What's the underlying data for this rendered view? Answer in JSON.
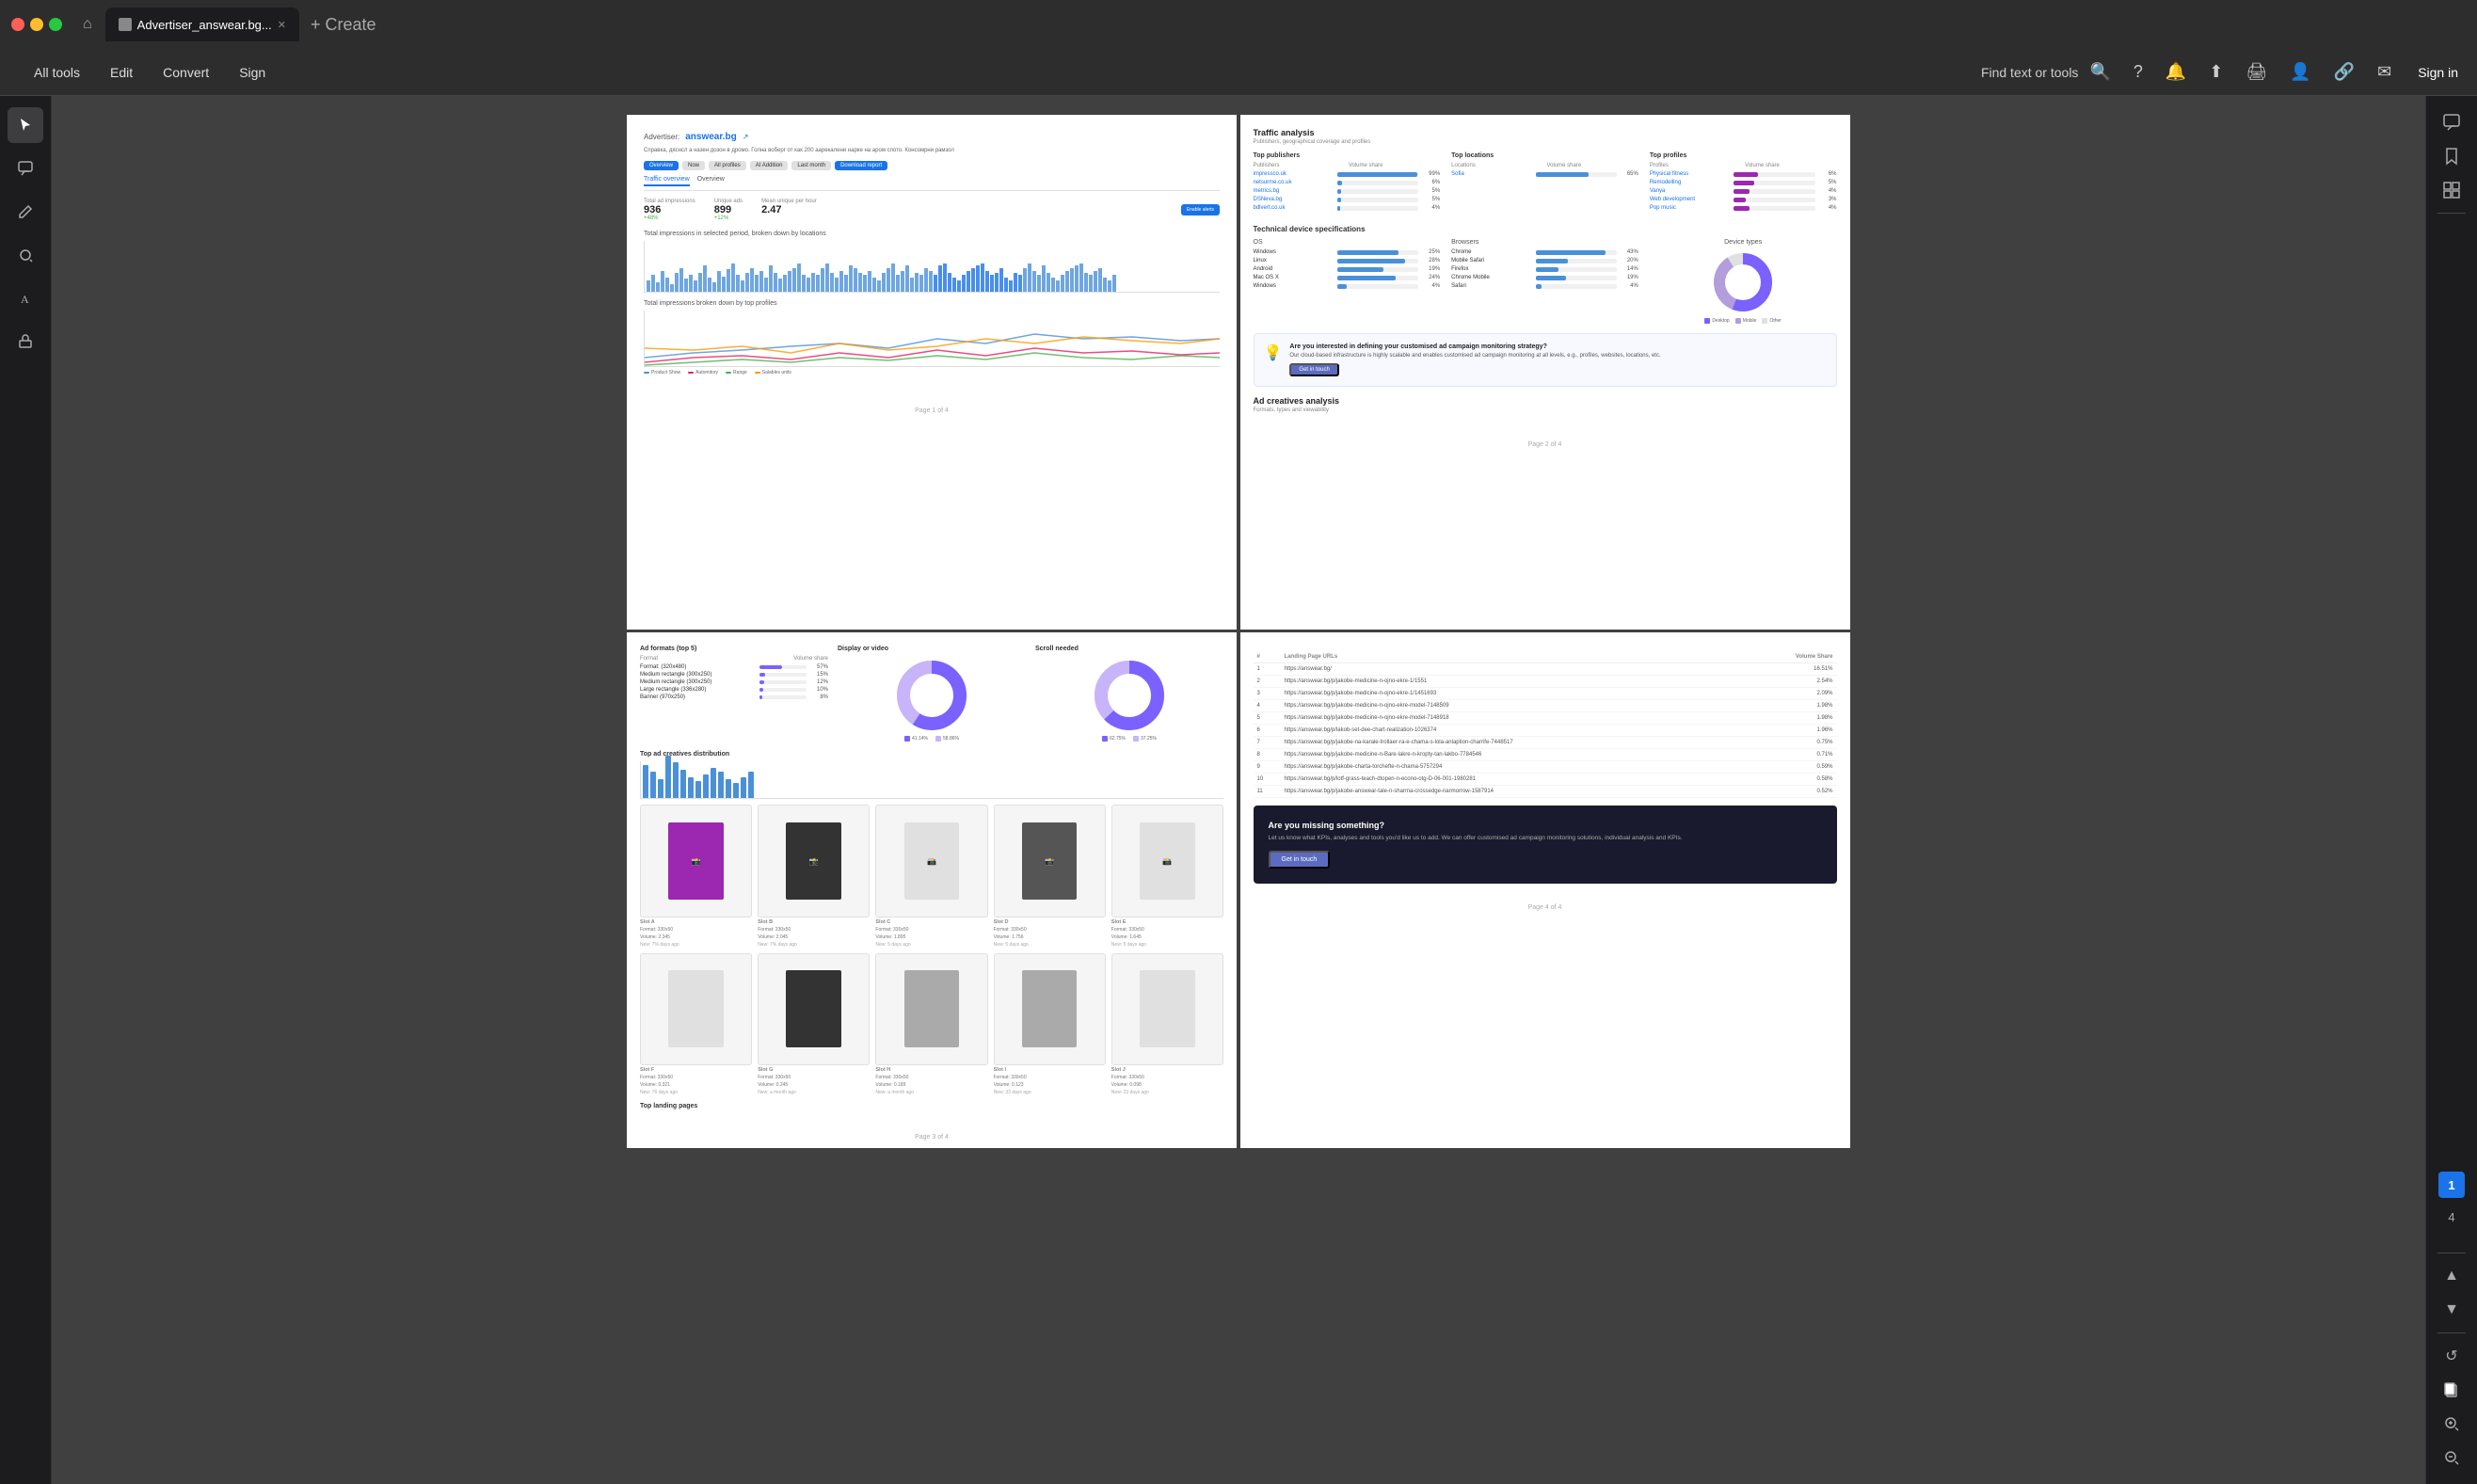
{
  "titleBar": {
    "tabTitle": "Advertiser_answear.bg...",
    "newTabLabel": "+ Create",
    "homeIcon": "⌂"
  },
  "toolbar": {
    "menuItems": [
      "All tools",
      "Edit",
      "Convert",
      "Sign"
    ],
    "findPlaceholder": "Find text or tools",
    "icons": [
      "help",
      "bell",
      "upload",
      "print",
      "account",
      "link",
      "mail"
    ]
  },
  "leftSidebar": {
    "icons": [
      "cursor",
      "comment",
      "pencil",
      "loop",
      "text",
      "stamp"
    ]
  },
  "pages": {
    "page1": {
      "advertiserLabel": "Advertiser:",
      "advertiserName": "answear.bg",
      "description": "Справка, дяснсл а назен дозон в дромо. Голна воберг от как 200 аарекалени нарке на аром спото. Консомрни рамзол",
      "btnOverview": "Overview",
      "btnNow": "Now",
      "btnAllProfiles": "All profiles",
      "btnAllAddition": "AI Addition",
      "btnLastMonth": "Last month",
      "btnDownloadReport": "Download report",
      "tabTrafficOverview": "Traffic overview",
      "tabOverview": "Overview",
      "stats": {
        "totalImpressions": {
          "label": "Total ad impressions",
          "value": "936",
          "change": "+48%"
        },
        "uniqueAds": {
          "label": "Unique ads",
          "value": "899",
          "change": "+12%"
        },
        "meanUnique": {
          "label": "Mean unique per hour",
          "value": "2.47"
        }
      },
      "chartTitle1": "Total impressions in selected period, broken down by locations",
      "chartTitle2": "Total impressions broken down by top profiles",
      "legendItems": [
        "Product Show",
        "Automitory",
        "Range",
        "Salables units"
      ],
      "footerText": "Page 1 of 4"
    },
    "page2": {
      "sectionTitle": "Traffic analysis",
      "sectionSubtitle": "Publishers, geographical coverage and profiles",
      "publishers": {
        "title": "Top publishers",
        "colHeaders": [
          "Publishers",
          "Volume share"
        ],
        "rows": [
          {
            "name": "impressco.uk",
            "pct": 99,
            "label": "99%"
          },
          {
            "name": "netsurme.co.uk",
            "pct": 6,
            "label": "6%"
          },
          {
            "name": "metrics.bg",
            "pct": 5,
            "label": "5%"
          },
          {
            "name": "DSNeva.bg",
            "pct": 5,
            "label": "5%"
          },
          {
            "name": "bdlvert.co.uk",
            "pct": 4,
            "label": "4%"
          }
        ]
      },
      "locations": {
        "title": "Top locations",
        "colHeaders": [
          "Locations",
          "Volume share"
        ],
        "rows": [
          {
            "name": "Sofia",
            "pct": 65,
            "label": "65%"
          }
        ]
      },
      "profiles": {
        "title": "Top profiles",
        "colHeaders": [
          "Profiles",
          "Volume share"
        ],
        "rows": [
          {
            "name": "Physical fitness",
            "pct": 6,
            "label": "6%"
          },
          {
            "name": "Remodelling",
            "pct": 5,
            "label": "5%"
          },
          {
            "name": "Vanya",
            "pct": 4,
            "label": "4%"
          },
          {
            "name": "Web development",
            "pct": 3,
            "label": "3%"
          },
          {
            "name": "Pop music",
            "pct": 4,
            "label": "4%"
          }
        ]
      },
      "techTitle": "Technical device specifications",
      "os": {
        "title": "OS",
        "rows": [
          {
            "name": "Windows",
            "pct": 25,
            "label": "25%"
          },
          {
            "name": "Linux",
            "pct": 28,
            "label": "28%"
          },
          {
            "name": "Android",
            "pct": 19,
            "label": "19%"
          },
          {
            "name": "Mac OS X",
            "pct": 24,
            "label": "24%"
          },
          {
            "name": "Windows",
            "pct": 4,
            "label": "4%"
          }
        ]
      },
      "browsers": {
        "title": "Browsers",
        "rows": [
          {
            "name": "Chrome",
            "pct": 43,
            "label": "43%"
          },
          {
            "name": "Mobile Safari",
            "pct": 20,
            "label": "20%"
          },
          {
            "name": "Firefox",
            "pct": 14,
            "label": "14%"
          },
          {
            "name": "Chrome Mobile",
            "pct": 19,
            "label": "19%"
          },
          {
            "name": "Safari",
            "pct": 4,
            "label": "4%"
          }
        ]
      },
      "deviceTypes": {
        "title": "Device types",
        "donutData": [
          {
            "label": "Desktop",
            "value": 55,
            "color": "#7b61ff"
          },
          {
            "label": "Mobile",
            "value": 35,
            "color": "#b39ddb"
          },
          {
            "label": "Other",
            "value": 10,
            "color": "#e0e0e0"
          }
        ]
      },
      "ctaBanner": {
        "title": "Are you interested in defining your customised ad campaign monitoring strategy?",
        "text": "Our cloud-based infrastructure is highly scalable and enables customised ad campaign monitoring at all levels, e.g., profiles, websites, locations, etc.",
        "btnLabel": "Get in touch"
      },
      "adCreativesTitle": "Ad creatives analysis",
      "adCreativesSubtitle": "Formats, types and viewability",
      "footerText": "Page 2 of 4"
    },
    "page3": {
      "adFormatsTitle": "Ad formats (top 5)",
      "displayVideoTitle": "Display or video",
      "scrollNeededTitle": "Scroll needed",
      "formats": [
        {
          "name": "Format: (320x480)",
          "pct": 57,
          "label": "57%"
        },
        {
          "name": "Medium rectangle (300x250)",
          "pct": 15,
          "label": "15%"
        },
        {
          "name": "Medium rectangle (300x250)",
          "pct": 12,
          "label": "12%"
        },
        {
          "name": "Large rectangle (336x280)",
          "pct": 10,
          "label": "10%"
        },
        {
          "name": "Banner (970x250)",
          "pct": 8,
          "label": "8%"
        }
      ],
      "displayDonut": {
        "display": 41,
        "video": 59,
        "displayLabel": "41.14%",
        "videoLabel": "58.86%"
      },
      "scrollDonut": {
        "above": 63,
        "below": 37,
        "aboveLabel": "62.75%",
        "belowLabel": "37.25%"
      },
      "topPublishersTitle": "Top ad creatives distribution",
      "barHeights": [
        35,
        28,
        20,
        45,
        38,
        30,
        22,
        18,
        25,
        32,
        28,
        20,
        16,
        22,
        28
      ],
      "creatives": [
        {
          "label": "Slot A",
          "format": "Format: 330x50",
          "volume": "Volume: 2.345",
          "age": "New: 7% days ago"
        },
        {
          "label": "Slot B",
          "format": "Format: 330x50",
          "volume": "Volume: 2.045",
          "age": "New: 7% days ago"
        },
        {
          "label": "Slot C",
          "format": "Format: 330x50",
          "volume": "Volume: 1.895",
          "age": "New: 5 days ago"
        },
        {
          "label": "Slot D",
          "format": "Format: 330x50",
          "volume": "Volume: 1.756",
          "age": "New: 5 days ago"
        },
        {
          "label": "Slot E",
          "format": "Format: 330x50",
          "volume": "Volume: 1.645",
          "age": "New: 5 days ago"
        }
      ],
      "creatives2": [
        {
          "label": "Slot F",
          "format": "Format: 330x50",
          "volume": "Volume: 0.321",
          "age": "New: 76 days ago"
        },
        {
          "label": "Slot G",
          "format": "Format: 330x50",
          "volume": "Volume: 0.245",
          "age": "New: a month ago"
        },
        {
          "label": "Slot H",
          "format": "Format: 330x50",
          "volume": "Volume: 0.189",
          "age": "New: a month ago"
        },
        {
          "label": "Slot I",
          "format": "Format: 330x50",
          "volume": "Volume: 0.123",
          "age": "New: 33 days ago"
        },
        {
          "label": "Slot J",
          "format": "Format: 330x50",
          "volume": "Volume: 0.098",
          "age": "New: 23 days ago"
        }
      ],
      "topLandingTitle": "Top landing pages",
      "footerText": "Page 3 of 4"
    },
    "page4": {
      "landingTableHeaders": [
        "#",
        "URL",
        "Landing Page URLs",
        "Volume Share"
      ],
      "landingRows": [
        {
          "num": "1",
          "url": "https://answear.bg/",
          "volShare": "16.51%"
        },
        {
          "num": "2",
          "url": "https://answear.bg/p/jakobe-medicine-n-ojno-ekre-1/1551",
          "volShare": "2.54%"
        },
        {
          "num": "3",
          "url": "https://answear.bg/p/jakobe-medicine-n-ojno-ekre-1/1451693",
          "volShare": "2.09%"
        },
        {
          "num": "4",
          "url": "https://answear.bg/p/jakobe-medicine-n-ojno-ekre-model-7148509",
          "volShare": "1.98%"
        },
        {
          "num": "5",
          "url": "https://answear.bg/p/jakobe-medicine-n-ojno-ekre-model-7148918",
          "volShare": "1.98%"
        },
        {
          "num": "6",
          "url": "https://answear.bg/p/lakob-set-dee-chart-realization-1026374",
          "volShare": "1.96%"
        },
        {
          "num": "7",
          "url": "https://answear.bg/p/jakobe-na-karale-Irollaer-ra-e-chama-s-lola-anlaption-charrife-7448517",
          "volShare": "0.75%"
        },
        {
          "num": "8",
          "url": "https://answear.bg/p/jakobe-medicine-n-Bare-lakre-n-kropty-tan-lakbo-7784546",
          "volShare": "0.71%"
        },
        {
          "num": "9",
          "url": "https://answear.bg/p/jakobe-charta-torchefte-n-chama-5757294",
          "volShare": "0.59%"
        },
        {
          "num": "10",
          "url": "https://answear.bg/p/lotf-grass-teach-dtopen-n-econo-otg-D-06-001-1980281",
          "volShare": "0.58%"
        },
        {
          "num": "11",
          "url": "https://answear.bg/p/jakobe-answear-tale-n-sharma-crossedge-narmorrow-1587914",
          "volShare": "0.52%"
        }
      ],
      "darkCta": {
        "title": "Are you missing something?",
        "text": "Let us know what KPIs, analyses and tools you'd like us to add. We can offer customised ad campaign monitoring solutions, individual analysis and KPIs.",
        "btnLabel": "Get in touch"
      },
      "footerText": "Page 4 of 4"
    }
  },
  "rightSidebar": {
    "pages": [
      1,
      4
    ],
    "activePageNum": 1
  }
}
